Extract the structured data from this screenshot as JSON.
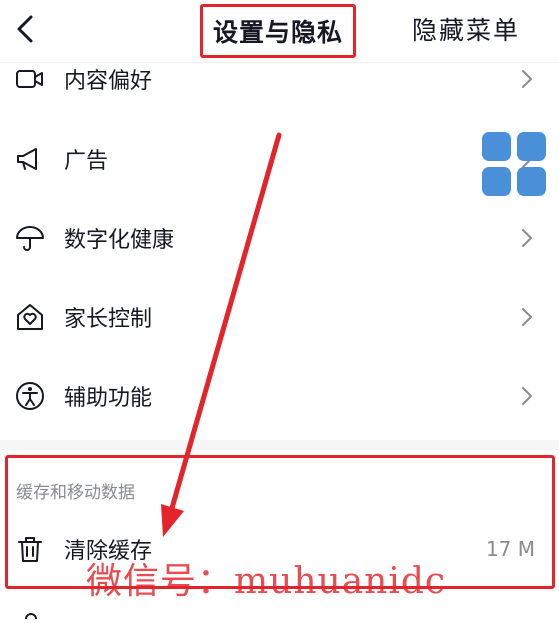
{
  "header": {
    "title": "设置与隐私",
    "right_label": "隐藏菜单"
  },
  "menu": [
    {
      "label": "内容偏好",
      "icon": "video-camera-icon"
    },
    {
      "label": "广告",
      "icon": "megaphone-icon"
    },
    {
      "label": "数字化健康",
      "icon": "umbrella-icon"
    },
    {
      "label": "家长控制",
      "icon": "house-heart-icon"
    },
    {
      "label": "辅助功能",
      "icon": "accessibility-icon"
    }
  ],
  "cache_section": {
    "header": "缓存和移动数据",
    "clear_cache": {
      "label": "清除缓存",
      "value": "17 M",
      "icon": "trash-icon"
    }
  },
  "watermark": "微信号：muhuanidc",
  "colors": {
    "highlight": "#e3242b",
    "widget": "#4a90d9",
    "text": "#161823",
    "secondary": "#8a8b91"
  }
}
